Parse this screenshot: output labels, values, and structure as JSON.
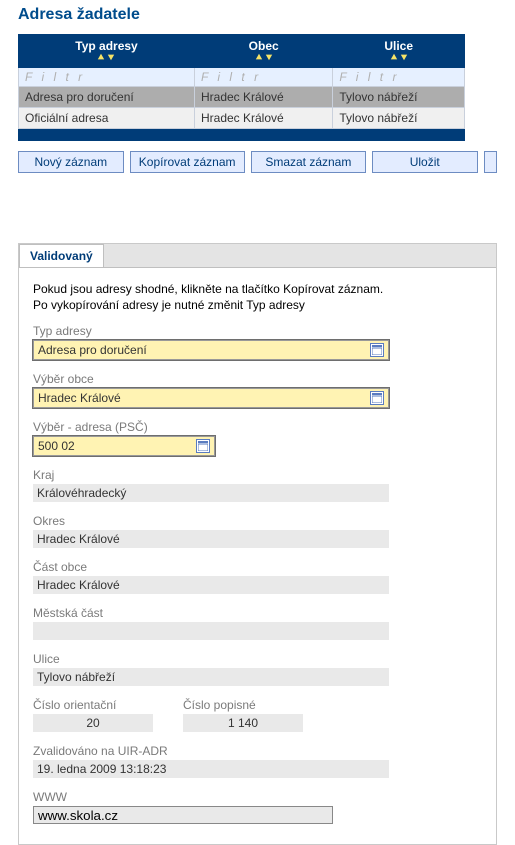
{
  "heading": "Adresa žadatele",
  "table": {
    "headers": [
      "Typ adresy",
      "Obec",
      "Ulice"
    ],
    "filter_placeholder": "F i l t r",
    "rows": [
      {
        "typ": "Adresa pro doručení",
        "obec": "Hradec Králové",
        "ulice": "Tylovo nábřeží"
      },
      {
        "typ": "Oficiální adresa",
        "obec": "Hradec Králové",
        "ulice": "Tylovo nábřeží"
      }
    ]
  },
  "buttons": {
    "novy": "Nový záznam",
    "kopir": "Kopírovat záznam",
    "smazat": "Smazat záznam",
    "ulozit": "Uložit"
  },
  "tab": {
    "label": "Validovaný"
  },
  "info": {
    "line1": "Pokud jsou adresy shodné, klikněte na tlačítko Kopírovat záznam.",
    "line2": "Po vykopírování adresy je nutné změnit Typ adresy"
  },
  "fields": {
    "typ_adresy": {
      "label": "Typ adresy",
      "value": "Adresa pro doručení"
    },
    "vyber_obce": {
      "label": "Výběr obce",
      "value": "Hradec Králové"
    },
    "vyber_adresa": {
      "label": "Výběr - adresa (PSČ)",
      "value": "500 02"
    },
    "kraj": {
      "label": "Kraj",
      "value": "Královéhradecký"
    },
    "okres": {
      "label": "Okres",
      "value": "Hradec Králové"
    },
    "cast_obce": {
      "label": "Část obce",
      "value": "Hradec Králové"
    },
    "mestska_cast": {
      "label": "Městská část",
      "value": ""
    },
    "ulice": {
      "label": "Ulice",
      "value": "Tylovo nábřeží"
    },
    "cislo_orient": {
      "label": "Číslo orientační",
      "value": "20"
    },
    "cislo_popis": {
      "label": "Číslo popisné",
      "value": "1 140"
    },
    "zvalidovano": {
      "label": "Zvalidováno na UIR-ADR",
      "value": "19. ledna 2009 13:18:23"
    },
    "www": {
      "label": "WWW",
      "value": "www.skola.cz"
    }
  }
}
